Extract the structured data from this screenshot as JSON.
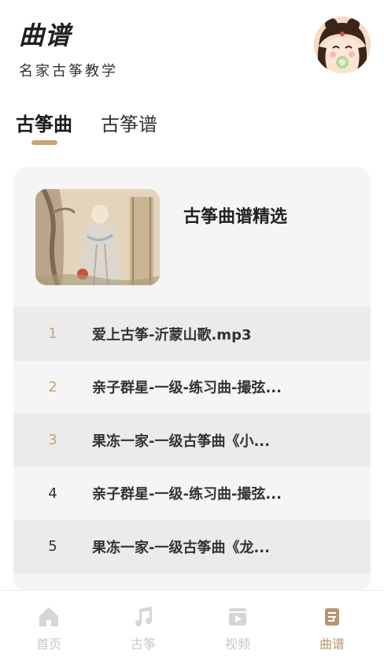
{
  "header": {
    "title": "曲谱",
    "subtitle": "名家古筝教学"
  },
  "tabs": [
    {
      "label": "古筝曲",
      "active": true
    },
    {
      "label": "古筝谱",
      "active": false
    }
  ],
  "card": {
    "title": "古筝曲谱精选",
    "items": [
      {
        "num": "1",
        "title": "爱上古筝-沂蒙山歌.mp3"
      },
      {
        "num": "2",
        "title": "亲子群星-一级-练习曲-撮弦..."
      },
      {
        "num": "3",
        "title": "果冻一家-一级古筝曲《小..."
      },
      {
        "num": "4",
        "title": "亲子群星-一级-练习曲-撮弦..."
      },
      {
        "num": "5",
        "title": "果冻一家-一级古筝曲《龙..."
      }
    ]
  },
  "bottom_nav": [
    {
      "label": "首页",
      "icon": "home-icon",
      "active": false
    },
    {
      "label": "古筝",
      "icon": "music-note-icon",
      "active": false
    },
    {
      "label": "视频",
      "icon": "video-icon",
      "active": false
    },
    {
      "label": "曲谱",
      "icon": "score-icon",
      "active": true
    }
  ],
  "colors": {
    "accent": "#c9a37a",
    "active_nav": "#b89572",
    "inactive_nav": "#c8c8c8",
    "row_shade": "#ebebeb",
    "card_bg": "#f5f5f5"
  }
}
